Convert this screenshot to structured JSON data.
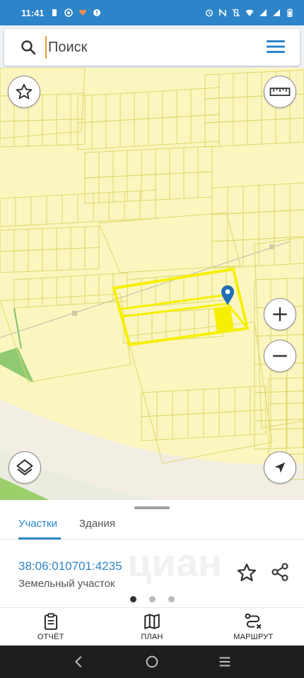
{
  "status_bar": {
    "time": "11:41",
    "left_icons": [
      "battery-saver-icon",
      "whatsapp-icon",
      "heart-icon",
      "alert-icon"
    ],
    "right_icons": [
      "alarm-icon",
      "nfc-icon",
      "vibrate-off-icon",
      "wifi-icon",
      "signal-icon",
      "signal-icon",
      "battery-icon"
    ]
  },
  "search": {
    "placeholder": "Поиск",
    "value": ""
  },
  "map": {
    "left_buttons": [
      "star-icon",
      "layers-icon"
    ],
    "right_buttons": [
      "ruler-icon",
      "zoom-in-icon",
      "zoom-out-icon",
      "locate-icon"
    ],
    "highlight_color": "#f6f000",
    "parcel_fill": "#fbf6bf",
    "parcel_stroke": "#ddd76b",
    "marker_color": "#1f6fb5"
  },
  "panel": {
    "tabs": [
      {
        "label": "Участки",
        "active": true
      },
      {
        "label": "Здания",
        "active": false
      }
    ],
    "parcel": {
      "number": "38:06:010701:4235",
      "type": "Земельный участок",
      "watermark": "циан"
    },
    "pager": {
      "count": 3,
      "active": 0
    }
  },
  "toolbar": {
    "items": [
      {
        "label": "ОТЧЁТ",
        "icon": "clipboard-icon"
      },
      {
        "label": "ПЛАН",
        "icon": "map-icon"
      },
      {
        "label": "МАРШРУТ",
        "icon": "route-icon"
      }
    ]
  },
  "navbar": {
    "icons": [
      "back-icon",
      "home-icon",
      "recents-icon"
    ]
  },
  "colors": {
    "accent": "#2c84c9",
    "status_bar": "#2c84c9"
  }
}
